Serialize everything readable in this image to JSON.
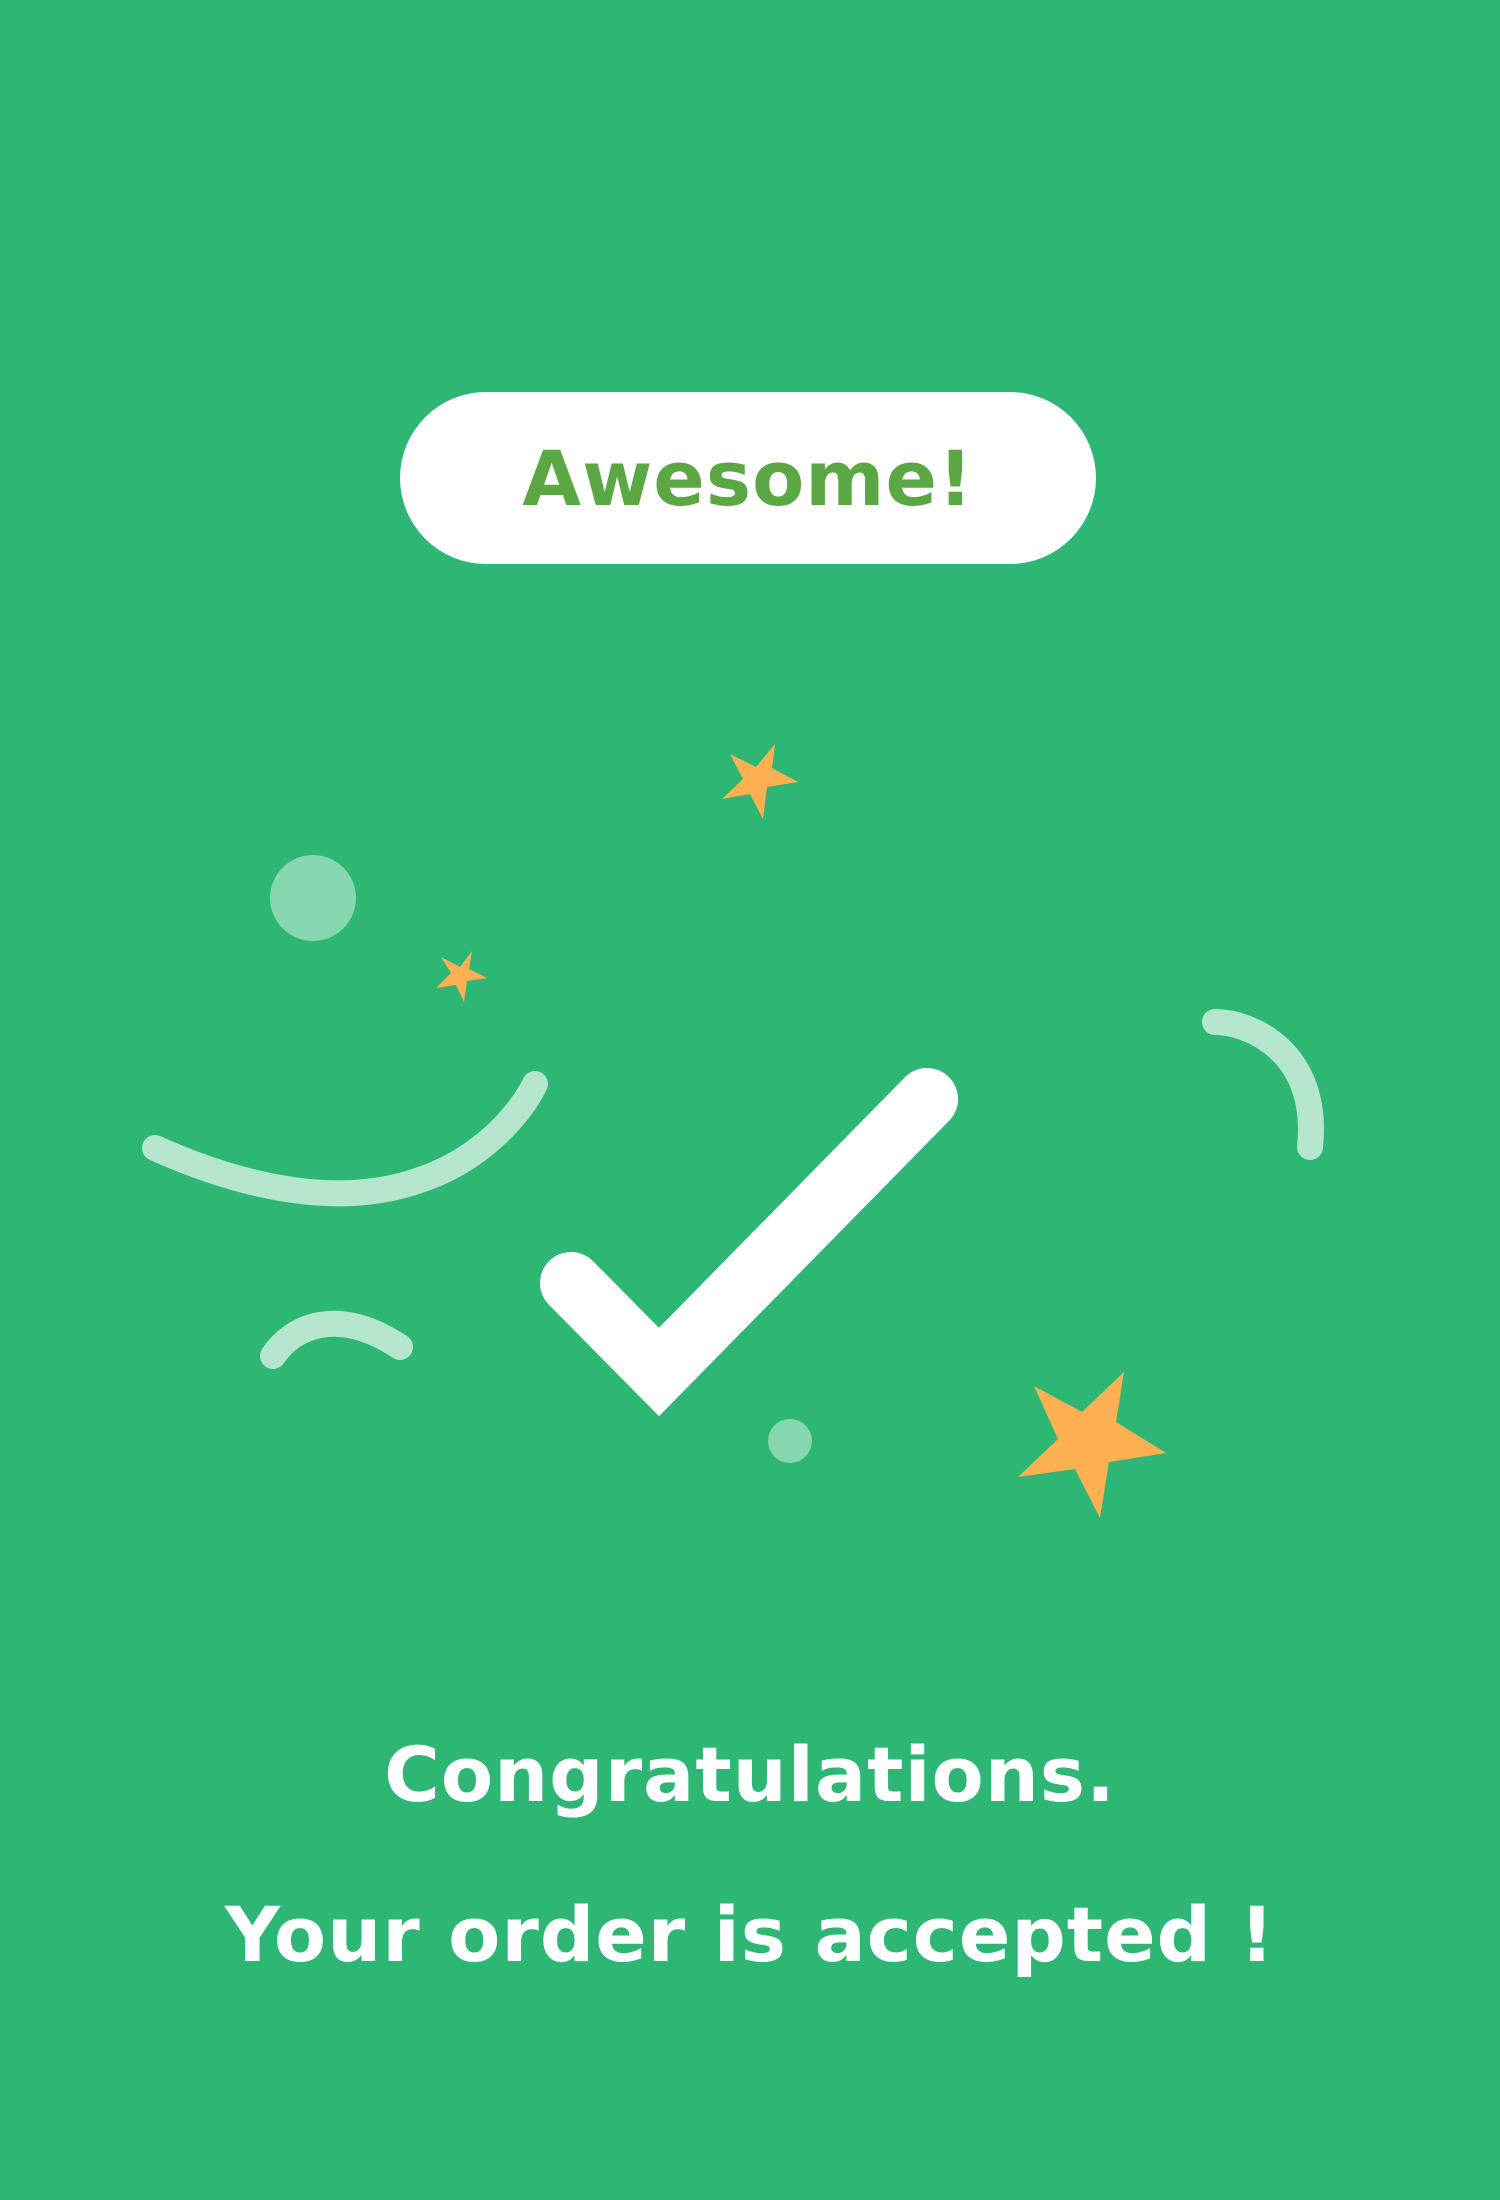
{
  "screen": {
    "background_color": "#2DB674"
  },
  "button": {
    "label": "Awesome!",
    "background_color": "#FFFFFF",
    "text_color": "#5BA744"
  },
  "illustration": {
    "icon": "checkmark-icon",
    "decorations": [
      "star-icon",
      "confetti-dot",
      "confetti-streamer"
    ],
    "star_color": "#FFB052",
    "confetti_color": "#B4E6CE"
  },
  "message": {
    "line1": "Congratulations.",
    "line2": "Your order is accepted !"
  }
}
